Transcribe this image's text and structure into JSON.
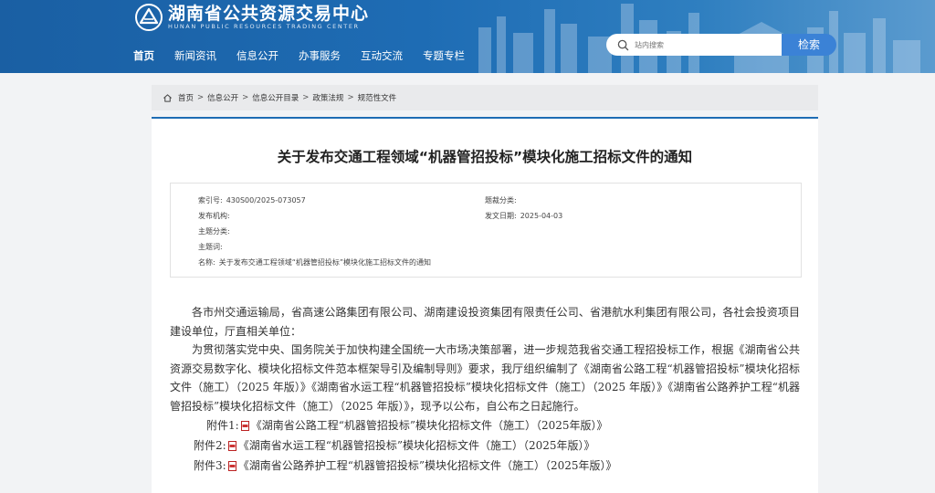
{
  "header": {
    "logo_cn": "湖南省公共资源交易中心",
    "logo_en": "HUNAN PUBLIC RESOURCES TRADING CENTER",
    "nav": [
      "首页",
      "新闻资讯",
      "信息公开",
      "办事服务",
      "互动交流",
      "专题专栏"
    ],
    "active_nav": "首页",
    "search_placeholder": "站内搜索",
    "search_button": "检索",
    "colors": {
      "primary": "#1e6cb4",
      "search_button": "#3b82d6"
    }
  },
  "breadcrumb": [
    "首页",
    "信息公开",
    "信息公开目录",
    "政策法规",
    "规范性文件"
  ],
  "article": {
    "title": "关于发布交通工程领域“机器管招投标”模块化施工招标文件的通知",
    "meta": {
      "index_no_label": "索引号:",
      "index_no": "430S00/2025-073057",
      "theme_label": "题裁分类:",
      "theme": "",
      "publisher_label": "发布机构:",
      "publisher": "",
      "date_label": "发文日期:",
      "date": "2025-04-03",
      "subject_cat_label": "主题分类:",
      "subject_cat": "",
      "subject_label": "主题词:",
      "subject": "",
      "name_label": "名称:",
      "name": "关于发布交通工程领域“机器管招投标”模块化施工招标文件的通知"
    },
    "paragraphs": [
      "各市州交通运输局，省高速公路集团有限公司、湖南建设投资集团有限责任公司、省港航水利集团有限公司，各社会投资项目建设单位，厅直相关单位：",
      "为贯彻落实党中央、国务院关于加快构建全国统一大市场决策部署，进一步规范我省交通工程招投标工作，根据《湖南省公共资源交易数字化、模块化招标文件范本框架导引及编制导则》要求，我厅组织编制了《湖南省公路工程“机器管招投标”模块化招标文件（施工）（2025 年版）》《湖南省水运工程“机器管招投标”模块化招标文件（施工）（2025 年版）》《湖南省公路养护工程“机器管招投标”模块化招标文件（施工）（2025 年版）》，现予以公布，自公布之日起施行。"
    ],
    "attachments": [
      {
        "label": "附件1:",
        "title": "《湖南省公路工程“机器管招投标”模块化招标文件（施工）（2025年版）》",
        "icon": "pdf-icon"
      },
      {
        "label": "附件2:",
        "title": "《湖南省水运工程“机器管招投标”模块化招标文件（施工）（2025年版）》",
        "icon": "pdf-icon"
      },
      {
        "label": "附件3:",
        "title": "《湖南省公路养护工程“机器管招投标”模块化招标文件（施工）（2025年版）》",
        "icon": "pdf-icon"
      }
    ]
  }
}
